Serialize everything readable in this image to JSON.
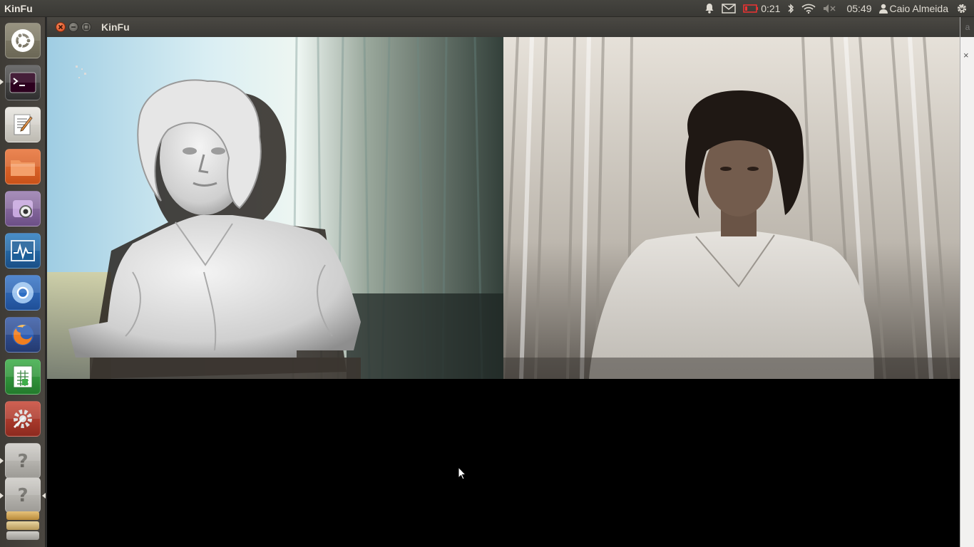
{
  "panel": {
    "app_name": "KinFu",
    "battery_time": "0:21",
    "clock": "05:49",
    "user_name": "Caio Almeida",
    "icons": [
      "bell-icon",
      "mail-icon",
      "battery-icon",
      "bluetooth-icon",
      "wifi-icon",
      "volume-muted-icon",
      "user-icon",
      "session-gear-icon"
    ]
  },
  "launcher": {
    "items": [
      {
        "name": "dash-home",
        "icon": "ubuntu-logo-icon"
      },
      {
        "name": "terminal",
        "icon": "terminal-icon"
      },
      {
        "name": "text-editor",
        "icon": "text-editor-icon"
      },
      {
        "name": "files",
        "icon": "folder-icon"
      },
      {
        "name": "cheese-webcam",
        "icon": "webcam-icon"
      },
      {
        "name": "system-monitor",
        "icon": "system-monitor-icon"
      },
      {
        "name": "chromium",
        "icon": "chromium-icon"
      },
      {
        "name": "firefox",
        "icon": "firefox-icon"
      },
      {
        "name": "spreadsheet",
        "icon": "spreadsheet-icon"
      },
      {
        "name": "system-settings",
        "icon": "settings-icon"
      },
      {
        "name": "unknown-app-1",
        "icon": "question-icon"
      },
      {
        "name": "unknown-app-2",
        "icon": "question-icon"
      }
    ]
  },
  "window": {
    "title": "KinFu",
    "left_view": "3d-reconstruction",
    "right_view": "rgb-camera-feed"
  },
  "sliver": {
    "top_text": "a",
    "close_glyph": "×"
  },
  "colors": {
    "panel_bg": "#3c3b37",
    "close_button": "#e4531e",
    "launcher_bg": "#44413c"
  }
}
